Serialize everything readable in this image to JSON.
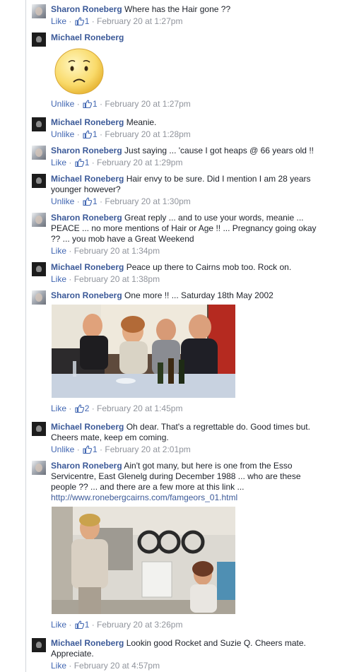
{
  "comments": [
    {
      "author": "Sharon Roneberg",
      "text": "Where has the Hair gone ??",
      "action": "Like",
      "likes": "1",
      "time": "February 20 at 1:27pm"
    },
    {
      "author": "Michael Roneberg",
      "text": "",
      "action": "Unlike",
      "likes": "1",
      "time": "February 20 at 1:27pm"
    },
    {
      "author": "Michael Roneberg",
      "text": "Meanie.",
      "action": "Unlike",
      "likes": "1",
      "time": "February 20 at 1:28pm"
    },
    {
      "author": "Sharon Roneberg",
      "text": "Just saying ... 'cause I got heaps @ 66 years old !!",
      "action": "Like",
      "likes": "1",
      "time": "February 20 at 1:29pm"
    },
    {
      "author": "Michael Roneberg",
      "text": "Hair envy to be sure. Did I mention I am 28 years younger however?",
      "action": "Unlike",
      "likes": "1",
      "time": "February 20 at 1:30pm"
    },
    {
      "author": "Sharon Roneberg",
      "text": "Great reply ... and to use your words, meanie ... PEACE ... no more mentions of Hair or Age !! ... Pregnancy going okay ?? ... you mob have a Great Weekend",
      "action": "Like",
      "likes": "",
      "time": "February 20 at 1:34pm"
    },
    {
      "author": "Michael Roneberg",
      "text": "Peace up there to Cairns mob too. Rock on.",
      "action": "Like",
      "likes": "",
      "time": "February 20 at 1:38pm"
    },
    {
      "author": "Sharon Roneberg",
      "text": "One more !! ... Saturday 18th May 2002",
      "action": "Like",
      "likes": "2",
      "time": "February 20 at 1:45pm"
    },
    {
      "author": "Michael Roneberg",
      "text": "Oh dear. That's a regrettable do. Good times but. Cheers mate, keep em coming.",
      "action": "Unlike",
      "likes": "1",
      "time": "February 20 at 2:01pm"
    },
    {
      "author": "Sharon Roneberg",
      "text": "Ain't got many, but here is one from the Esso Servicentre, East Glenelg during December 1988 ... who are these people ?? ... and there are a few more at this link ...",
      "link": "http://www.ronebergcairns.com/famgeors_01.html",
      "action": "Like",
      "likes": "1",
      "time": "February 20 at 3:26pm"
    },
    {
      "author": "Michael Roneberg",
      "text": "Lookin good Rocket and Suzie Q. Cheers mate. Appreciate.",
      "action": "Like",
      "likes": "",
      "time": "February 20 at 4:57pm"
    }
  ],
  "colors": {
    "name": "#3b5998",
    "link": "#4267b2",
    "meta": "#90949c",
    "text": "#1d2129"
  }
}
